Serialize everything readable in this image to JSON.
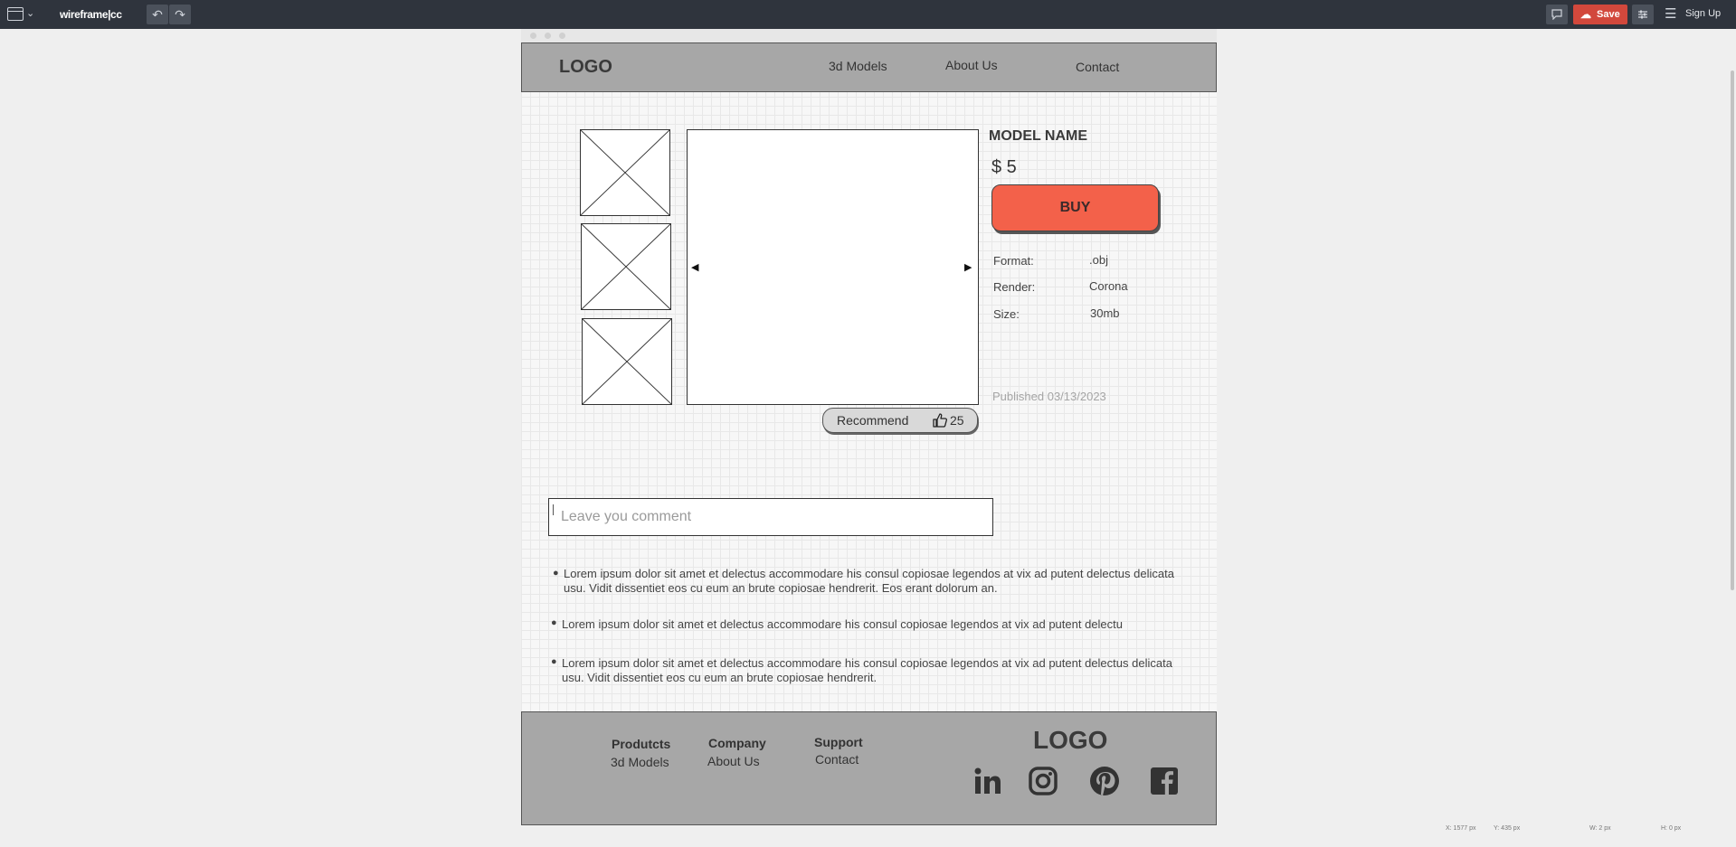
{
  "app": {
    "brand": "wireframe|cc",
    "save_label": "Save",
    "signup_label": "Sign Up"
  },
  "site": {
    "logo": "LOGO",
    "nav": [
      "3d Models",
      "About Us",
      "Contact"
    ]
  },
  "product": {
    "model_name": "MODEL NAME",
    "price": "$ 5",
    "buy_label": "BUY",
    "specs": [
      {
        "label": "Format:",
        "value": ".obj"
      },
      {
        "label": "Render:",
        "value": "Corona"
      },
      {
        "label": "Size:",
        "value": "30mb"
      }
    ],
    "published": "Published 03/13/2023",
    "recommend_label": "Recommend",
    "recommend_count": "25"
  },
  "comments": {
    "placeholder": "Leave you comment",
    "items": [
      "Lorem ipsum dolor sit amet et delectus accommodare his consul copiosae legendos at vix ad putent delectus delicata usu. Vidit dissentiet eos cu eum an brute copiosae hendrerit. Eos erant dolorum an.",
      "Lorem ipsum dolor sit amet et delectus accommodare his consul copiosae legendos at vix ad putent delectu",
      "Lorem ipsum dolor sit amet et delectus accommodare his consul copiosae legendos at vix ad putent delectus delicata usu. Vidit dissentiet eos cu eum an brute copiosae hendrerit."
    ]
  },
  "footer": {
    "col1": {
      "heading": "Produtcts",
      "link": "3d Models"
    },
    "col2": {
      "heading": "Company",
      "link": "About Us"
    },
    "col3": {
      "heading": "Support",
      "link": "Contact"
    },
    "logo": "LOGO",
    "social_icons": [
      "linkedin-icon",
      "instagram-icon",
      "pinterest-icon",
      "facebook-icon"
    ]
  },
  "status": {
    "x": "X: 1577 px",
    "y": "Y: 435 px",
    "w": "W: 2 px",
    "h": "H: 0 px"
  },
  "colors": {
    "buy_button": "#f3614a",
    "save_button": "#d2483c",
    "topbar": "#2f343d",
    "header_footer": "#a7a7a7"
  }
}
